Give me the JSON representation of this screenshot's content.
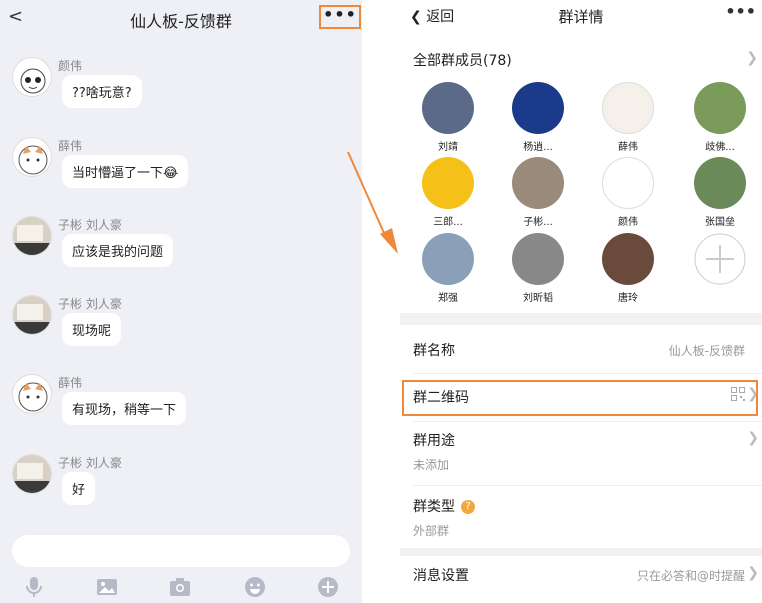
{
  "left": {
    "title": "仙人板-反馈群",
    "back_glyph": "<",
    "more_glyph": "•••",
    "messages": [
      {
        "sender": "颜伟",
        "text": "??啥玩意?",
        "avatar": "cat-sketch-avatar"
      },
      {
        "sender": "薛伟",
        "text": "当时懵逼了一下😂",
        "avatar": "cat-avatar"
      },
      {
        "sender": "子彬 刘人豪",
        "text": "应该是我的问题",
        "avatar": "typewriter-avatar"
      },
      {
        "sender": "子彬 刘人豪",
        "text": "现场呢",
        "avatar": "typewriter-avatar"
      },
      {
        "sender": "薛伟",
        "text": "有现场，稍等一下",
        "avatar": "cat-avatar"
      },
      {
        "sender": "子彬 刘人豪",
        "text": "好",
        "avatar": "typewriter-avatar"
      }
    ],
    "toolbar": [
      "microphone-icon",
      "image-icon",
      "camera-icon",
      "emoji-icon",
      "plus-icon"
    ]
  },
  "right": {
    "back_label": "返回",
    "title": "群详情",
    "more_glyph": "•••",
    "members_header": "全部群成员(78)",
    "members": [
      {
        "name": "刘靖",
        "color": "#5a6a88"
      },
      {
        "name": "杨逍...",
        "color": "#1c3a8a"
      },
      {
        "name": "薛伟",
        "color": "#f5f0ea"
      },
      {
        "name": "歧佛...",
        "color": "#7a9a5a"
      },
      {
        "name": "三郎...",
        "color": "#f5c018"
      },
      {
        "name": "子彬...",
        "color": "#9a8a7a"
      },
      {
        "name": "颜伟",
        "color": "#ffffff"
      },
      {
        "name": "张国垒",
        "color": "#6a8a5a"
      },
      {
        "name": "郑强",
        "color": "#8aa0b8"
      },
      {
        "name": "刘昕韬",
        "color": "#888888"
      },
      {
        "name": "唐玲",
        "color": "#6a4a3a"
      }
    ],
    "group_name_label": "群名称",
    "group_name_value": "仙人板-反馈群",
    "qr_label": "群二维码",
    "purpose_label": "群用途",
    "purpose_value": "未添加",
    "type_label": "群类型",
    "type_badge": "?",
    "type_value": "外部群",
    "msg_label": "消息设置",
    "msg_value": "只在必答和@时提醒"
  },
  "colors": {
    "highlight": "#f0883a",
    "chat_bg": "#eef0f5"
  }
}
